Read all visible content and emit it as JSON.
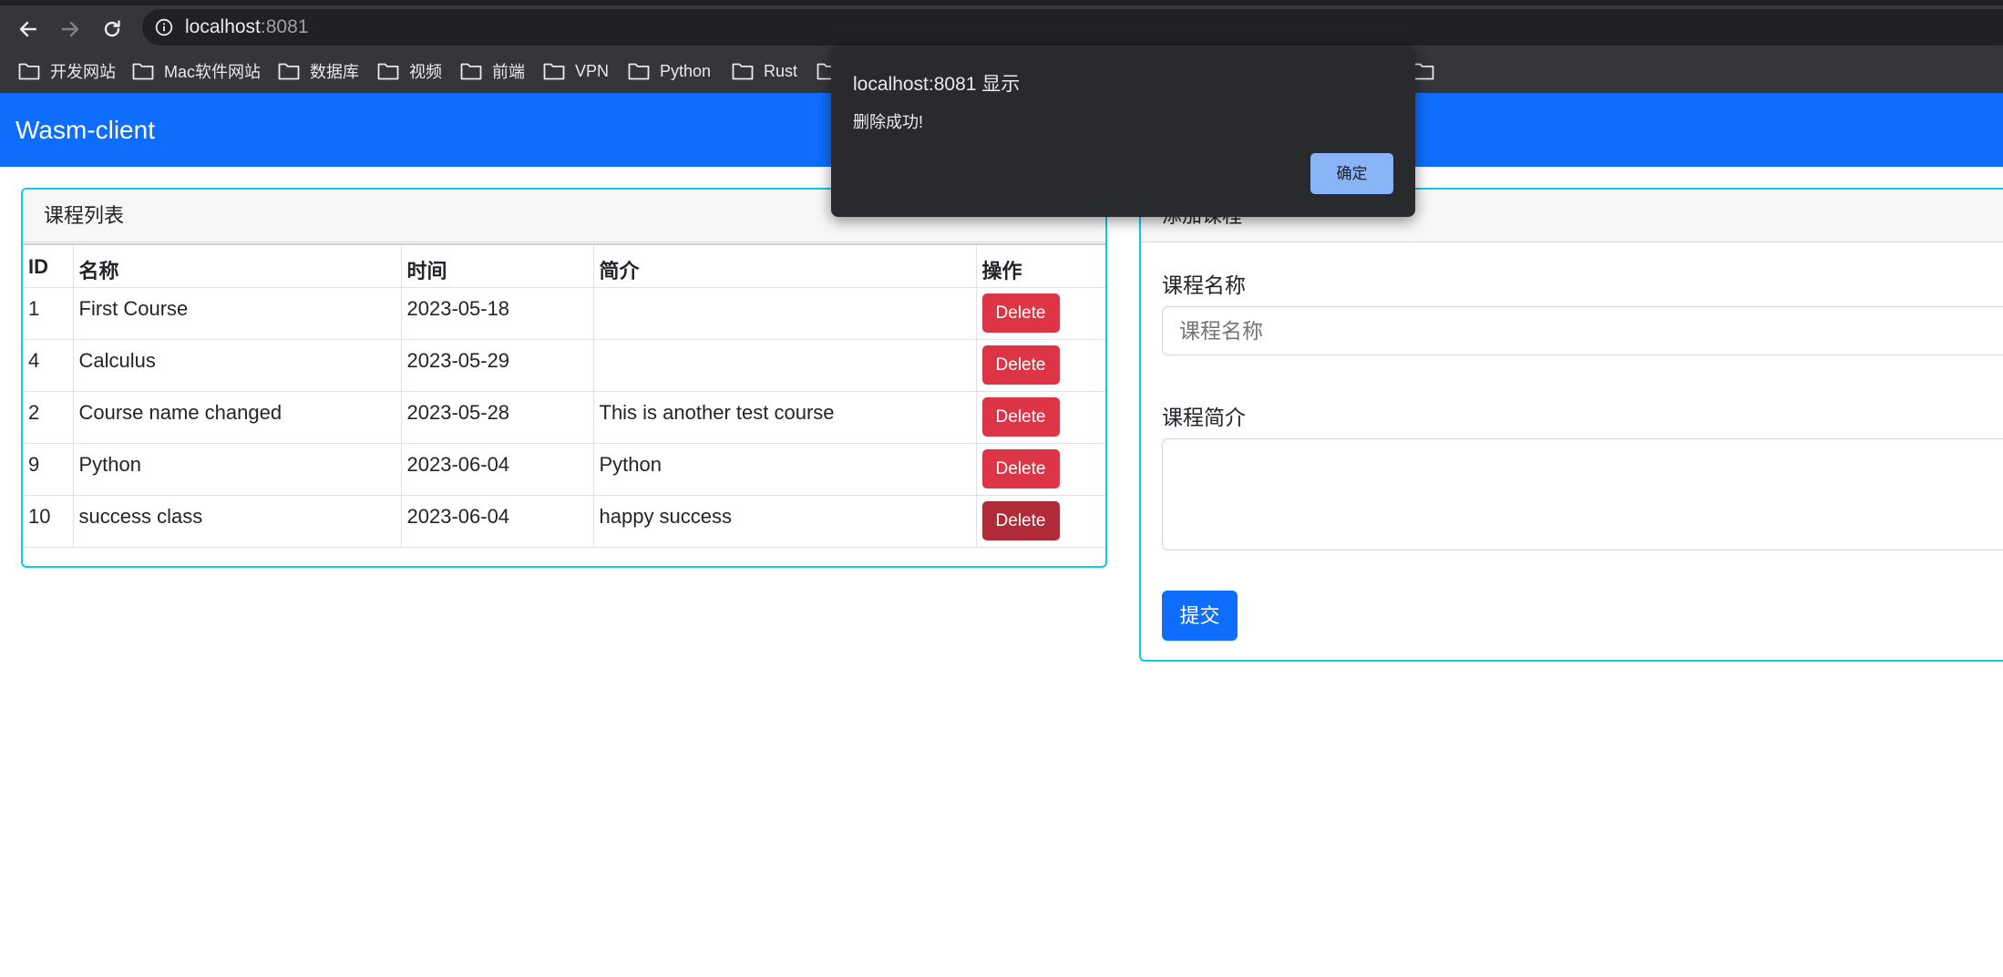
{
  "browser": {
    "url_host": "localhost",
    "url_port": ":8081",
    "bookmarks": [
      "开发网站",
      "Mac软件网站",
      "数据库",
      "视频",
      "前端",
      "VPN",
      "Python",
      "Rust"
    ]
  },
  "navbar": {
    "brand": "Wasm-client"
  },
  "course_list": {
    "title": "课程列表",
    "columns": [
      "ID",
      "名称",
      "时间",
      "简介",
      "操作"
    ],
    "rows": [
      {
        "id": "1",
        "name": "First Course",
        "time": "2023-05-18",
        "desc": "",
        "action": "Delete"
      },
      {
        "id": "4",
        "name": "Calculus",
        "time": "2023-05-29",
        "desc": "",
        "action": "Delete"
      },
      {
        "id": "2",
        "name": "Course name changed",
        "time": "2023-05-28",
        "desc": "This is another test course",
        "action": "Delete"
      },
      {
        "id": "9",
        "name": "Python",
        "time": "2023-06-04",
        "desc": "Python",
        "action": "Delete"
      },
      {
        "id": "10",
        "name": "success class",
        "time": "2023-06-04",
        "desc": "happy success",
        "action": "Delete"
      }
    ]
  },
  "add_course": {
    "title": "添加课程",
    "name_label": "课程名称",
    "name_placeholder": "课程名称",
    "desc_label": "课程简介",
    "desc_value": "",
    "submit_label": "提交"
  },
  "dialog": {
    "title": "localhost:8081 显示",
    "message": "删除成功!",
    "ok_label": "确定"
  },
  "colors": {
    "primary": "#0d6efd",
    "danger": "#dc3545",
    "danger_active": "#b02a37",
    "card_border": "#0dcaf0",
    "dialog_button": "#8ab4f8"
  }
}
